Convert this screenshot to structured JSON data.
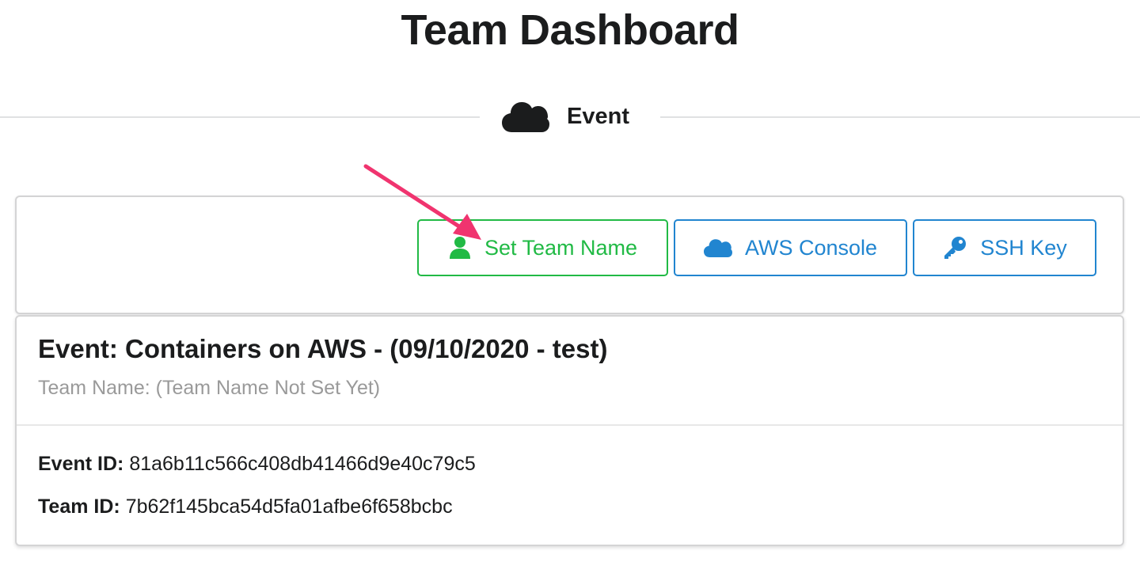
{
  "page": {
    "title": "Team Dashboard"
  },
  "section": {
    "label": "Event",
    "icon": "cloud-icon"
  },
  "actions": {
    "set_team_name": {
      "label": "Set Team Name",
      "icon": "user-icon",
      "color": "#21ba45"
    },
    "aws_console": {
      "label": "AWS Console",
      "icon": "cloud-icon",
      "color": "#2185d0"
    },
    "ssh_key": {
      "label": "SSH Key",
      "icon": "key-icon",
      "color": "#2185d0"
    }
  },
  "annotation": {
    "arrow_color": "#f0346f"
  },
  "event": {
    "title": "Event: Containers on AWS - (09/10/2020 - test)",
    "team_name": "Team Name: (Team Name Not Set Yet)",
    "event_id_label": "Event ID:",
    "event_id_value": "81a6b11c566c408db41466d9e40c79c5",
    "team_id_label": "Team ID:",
    "team_id_value": "7b62f145bca54d5fa01afbe6f658bcbc"
  }
}
